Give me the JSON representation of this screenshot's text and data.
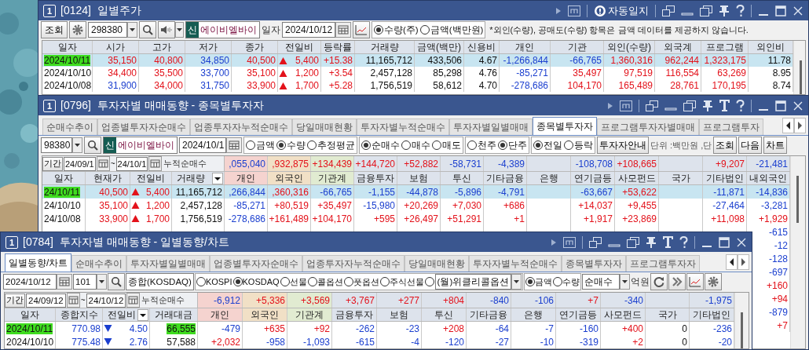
{
  "daily_price_window": {
    "screen_badge": "1",
    "title": "[0124]  일별주가",
    "auto_log_label": "자동일지",
    "toolbar": {
      "query_button": "조회",
      "code": "298380",
      "market_badge": "신",
      "stock_name": "에이비엘바이",
      "date_label": "일자",
      "date": "2024/10/12",
      "unit_options": [
        {
          "label": "수량(주)",
          "selected": true
        },
        {
          "label": "금액(백만원)",
          "selected": false
        }
      ],
      "notice": "*외인(수량), 공매도(수량) 항목은 금액 데이터를 제공하지 않습니다."
    },
    "table": {
      "columns": [
        {
          "label": "일자",
          "kind": "text"
        },
        {
          "label": "시가",
          "kind": "text"
        },
        {
          "label": "고가",
          "kind": "text"
        },
        {
          "label": "저가",
          "kind": "text"
        },
        {
          "label": "종가",
          "kind": "text"
        },
        {
          "label": "전일비",
          "kind": "change"
        },
        {
          "label": "등락률",
          "kind": "text"
        },
        {
          "label": "거래량",
          "kind": "text"
        },
        {
          "label": "금액(백만)",
          "kind": "text"
        },
        {
          "label": "신용비",
          "kind": "text"
        },
        {
          "label": "개인",
          "kind": "text"
        },
        {
          "label": "기관",
          "kind": "text"
        },
        {
          "label": "외인(수량)",
          "kind": "text"
        },
        {
          "label": "외국계",
          "kind": "text"
        },
        {
          "label": "프로그램",
          "kind": "text"
        },
        {
          "label": "외인비",
          "kind": "text"
        }
      ],
      "rows": [
        {
          "selected": true,
          "cells": [
            {
              "text": "2024/10/11",
              "highlighted": true
            },
            {
              "text": "35,150",
              "color": "#e3121b"
            },
            {
              "text": "40,800",
              "color": "#e3121b"
            },
            {
              "text": "34,850",
              "color": "#1b3fcf"
            },
            {
              "text": "40,500",
              "color": "#e3121b"
            },
            {
              "text": "5,400",
              "color": "#e3121b",
              "rising": true
            },
            {
              "text": "+15.38",
              "color": "#e3121b"
            },
            {
              "text": "11,165,712"
            },
            {
              "text": "433,506"
            },
            {
              "text": "4.67"
            },
            {
              "text": "-1,266,844",
              "color": "#1b3fcf"
            },
            {
              "text": "-66,765",
              "color": "#1b3fcf"
            },
            {
              "text": "1,360,316",
              "color": "#e3121b"
            },
            {
              "text": "962,244",
              "color": "#e3121b"
            },
            {
              "text": "1,323,175",
              "color": "#e3121b"
            },
            {
              "text": "11.78"
            }
          ]
        },
        {
          "selected": false,
          "cells": [
            {
              "text": "2024/10/10",
              "highlighted": false
            },
            {
              "text": "34,400",
              "color": "#e3121b"
            },
            {
              "text": "35,500",
              "color": "#e3121b"
            },
            {
              "text": "33,700",
              "color": "#1b3fcf"
            },
            {
              "text": "35,100",
              "color": "#e3121b"
            },
            {
              "text": "1,200",
              "color": "#e3121b",
              "rising": true
            },
            {
              "text": "+3.54",
              "color": "#e3121b"
            },
            {
              "text": "2,457,128"
            },
            {
              "text": "85,298"
            },
            {
              "text": "4.76"
            },
            {
              "text": "-85,271",
              "color": "#1b3fcf"
            },
            {
              "text": "35,497",
              "color": "#e3121b"
            },
            {
              "text": "97,519",
              "color": "#e3121b"
            },
            {
              "text": "116,554",
              "color": "#e3121b"
            },
            {
              "text": "63,269",
              "color": "#e3121b"
            },
            {
              "text": "8.95"
            }
          ]
        },
        {
          "selected": false,
          "cells": [
            {
              "text": "2024/10/08",
              "highlighted": false
            },
            {
              "text": "31,900",
              "color": "#1b3fcf"
            },
            {
              "text": "34,000",
              "color": "#e3121b"
            },
            {
              "text": "31,750",
              "color": "#1b3fcf"
            },
            {
              "text": "33,900",
              "color": "#e3121b"
            },
            {
              "text": "1,700",
              "color": "#e3121b",
              "rising": true
            },
            {
              "text": "+5.28",
              "color": "#e3121b"
            },
            {
              "text": "1,756,519"
            },
            {
              "text": "58,612"
            },
            {
              "text": "4.70"
            },
            {
              "text": "-278,686",
              "color": "#1b3fcf"
            },
            {
              "text": "104,170",
              "color": "#e3121b"
            },
            {
              "text": "165,489",
              "color": "#e3121b"
            },
            {
              "text": "28,761",
              "color": "#e3121b"
            },
            {
              "text": "170,195",
              "color": "#e3121b"
            },
            {
              "text": "8.74"
            }
          ]
        }
      ]
    }
  },
  "investor_by_stock_window": {
    "screen_badge": "1",
    "title": "[0796]  투자자별 매매동향 - 종목별투자자",
    "tabs": [
      {
        "label": "순매수추이",
        "selected": false
      },
      {
        "label": "업종별투자자순매수",
        "selected": false
      },
      {
        "label": "업종투자자누적순매수",
        "selected": false
      },
      {
        "label": "당일매매현황",
        "selected": false
      },
      {
        "label": "투자자별누적순매수",
        "selected": false
      },
      {
        "label": "투자자별일별매매",
        "selected": false
      },
      {
        "label": "종목별투자자",
        "selected": true
      },
      {
        "label": "프로그램투자자별매매",
        "selected": false
      },
      {
        "label": "프로그램투자",
        "selected": false
      }
    ],
    "toolbar": {
      "code": "98380",
      "market_badge": "신",
      "stock_name": "에이비엘바이",
      "date": "2024/10/1",
      "radio_groups": [
        [
          {
            "label": "금액",
            "selected": false
          },
          {
            "label": "수량",
            "selected": true
          },
          {
            "label": "추정평균",
            "selected": false
          }
        ],
        [
          {
            "label": "순매수",
            "selected": true
          },
          {
            "label": "매수",
            "selected": false
          },
          {
            "label": "매도",
            "selected": false
          }
        ],
        [
          {
            "label": "천주",
            "selected": false
          },
          {
            "label": "단주",
            "selected": true
          }
        ],
        [
          {
            "label": "전일",
            "selected": true
          },
          {
            "label": "등락",
            "selected": false
          }
        ]
      ],
      "guide_button": "투자자안내",
      "unit_note": "단위 :백만원 ,단",
      "buttons": [
        "조회",
        "다음",
        "차트"
      ]
    },
    "summary": {
      "period_button": "기간",
      "from": "24/09/1",
      "tilde": "~",
      "to": "24/10/1",
      "label": "누적순매수"
    },
    "table": {
      "columns": [
        {
          "label": "일자",
          "kind": "text"
        },
        {
          "label": "현재가",
          "kind": "text"
        },
        {
          "label": "전일비",
          "kind": "change"
        },
        {
          "label": "거래량",
          "kind": "text",
          "has_menu": true
        },
        {
          "label": "개인",
          "kind": "text",
          "color": "#f5d3cf",
          "total": {
            "text": ",055,040",
            "color": "#1b3fcf"
          }
        },
        {
          "label": "외국인",
          "kind": "text",
          "color": "#f1e0c6",
          "total": {
            "text": ",932,875",
            "color": "#e3121b"
          }
        },
        {
          "label": "기관계",
          "kind": "text",
          "color": "#e1ebd1",
          "total": {
            "text": "+134,439",
            "color": "#e3121b"
          }
        },
        {
          "label": "금융투자",
          "kind": "text",
          "total": {
            "text": "+144,720",
            "color": "#e3121b"
          }
        },
        {
          "label": "보험",
          "kind": "text",
          "total": {
            "text": "+52,882",
            "color": "#e3121b"
          }
        },
        {
          "label": "투신",
          "kind": "text",
          "total": {
            "text": "-58,731",
            "color": "#1b3fcf"
          }
        },
        {
          "label": "기타금융",
          "kind": "text",
          "total": {
            "text": "-4,389",
            "color": "#1b3fcf"
          }
        },
        {
          "label": "은행",
          "kind": "text"
        },
        {
          "label": "연기금등",
          "kind": "text",
          "total": {
            "text": "-108,708",
            "color": "#1b3fcf"
          }
        },
        {
          "label": "사모펀드",
          "kind": "text",
          "total": {
            "text": "+108,665",
            "color": "#e3121b"
          }
        },
        {
          "label": "국가",
          "kind": "text"
        },
        {
          "label": "기타법인",
          "kind": "text",
          "total": {
            "text": "+9,207",
            "color": "#e3121b"
          }
        },
        {
          "label": "내외국인",
          "kind": "text",
          "total": {
            "text": "-21,481",
            "color": "#1b3fcf"
          }
        }
      ],
      "rows": [
        {
          "selected": true,
          "cells": [
            {
              "text": "24/10/11",
              "highlighted": true
            },
            {
              "text": "40,500",
              "color": "#e3121b"
            },
            {
              "text": "5,400",
              "color": "#e3121b",
              "rising": true
            },
            {
              "text": "11,165,712"
            },
            {
              "text": ",266,844",
              "color": "#1b3fcf"
            },
            {
              "text": ",360,316",
              "color": "#e3121b"
            },
            {
              "text": "-66,765",
              "color": "#1b3fcf"
            },
            {
              "text": "-1,155",
              "color": "#1b3fcf"
            },
            {
              "text": "-44,878",
              "color": "#1b3fcf"
            },
            {
              "text": "-5,896",
              "color": "#1b3fcf"
            },
            {
              "text": "-4,791",
              "color": "#1b3fcf"
            },
            {},
            {
              "text": "-63,667",
              "color": "#1b3fcf"
            },
            {
              "text": "+53,622",
              "color": "#e3121b"
            },
            {},
            {
              "text": "-11,871",
              "color": "#1b3fcf"
            },
            {
              "text": "-14,836",
              "color": "#1b3fcf"
            }
          ]
        },
        {
          "selected": false,
          "cells": [
            {
              "text": "24/10/10",
              "highlighted": false
            },
            {
              "text": "35,100",
              "color": "#e3121b"
            },
            {
              "text": "1,200",
              "color": "#e3121b",
              "rising": true
            },
            {
              "text": "2,457,128"
            },
            {
              "text": "-85,271",
              "color": "#1b3fcf"
            },
            {
              "text": "+80,519",
              "color": "#e3121b"
            },
            {
              "text": "+35,497",
              "color": "#e3121b"
            },
            {
              "text": "-15,980",
              "color": "#1b3fcf"
            },
            {
              "text": "+20,269",
              "color": "#e3121b"
            },
            {
              "text": "+7,030",
              "color": "#e3121b"
            },
            {
              "text": "+686",
              "color": "#e3121b"
            },
            {},
            {
              "text": "+14,037",
              "color": "#e3121b"
            },
            {
              "text": "+9,455",
              "color": "#e3121b"
            },
            {},
            {
              "text": "-27,464",
              "color": "#1b3fcf"
            },
            {
              "text": "-3,281",
              "color": "#1b3fcf"
            }
          ]
        },
        {
          "selected": false,
          "cells": [
            {
              "text": "24/10/08",
              "highlighted": false
            },
            {
              "text": "33,900",
              "color": "#e3121b"
            },
            {
              "text": "1,700",
              "color": "#e3121b",
              "rising": true
            },
            {
              "text": "1,756,519"
            },
            {
              "text": "-278,686",
              "color": "#1b3fcf"
            },
            {
              "text": "+161,489",
              "color": "#e3121b"
            },
            {
              "text": "+104,170",
              "color": "#e3121b"
            },
            {
              "text": "+595",
              "color": "#e3121b"
            },
            {
              "text": "+26,497",
              "color": "#e3121b"
            },
            {
              "text": "+51,291",
              "color": "#e3121b"
            },
            {
              "text": "+1",
              "color": "#e3121b"
            },
            {},
            {
              "text": "+1,917",
              "color": "#e3121b"
            },
            {
              "text": "+23,869",
              "color": "#e3121b"
            },
            {},
            {
              "text": "+11,098",
              "color": "#e3121b"
            },
            {
              "text": "+1,929",
              "color": "#e3121b"
            }
          ]
        }
      ],
      "lower_last_column": [
        {
          "text": "-615",
          "color": "#1b3fcf"
        },
        {
          "text": "-12",
          "color": "#1b3fcf"
        },
        {
          "text": "-128",
          "color": "#1b3fcf"
        },
        {
          "text": "-697",
          "color": "#1b3fcf"
        },
        {
          "text": "+160",
          "color": "#e3121b"
        },
        {
          "text": "+94",
          "color": "#e3121b"
        },
        {
          "text": "-879",
          "color": "#1b3fcf"
        },
        {
          "text": "+7",
          "color": "#e3121b"
        }
      ]
    }
  },
  "daily_trend_window": {
    "screen_badge": "1",
    "title": "[0784]  투자자별 매매동향 - 일별동향/차트",
    "tabs": [
      {
        "label": "일별동향/차트",
        "selected": true
      },
      {
        "label": "순매수추이",
        "selected": false
      },
      {
        "label": "투자자별일별매매",
        "selected": false
      },
      {
        "label": "업종별투자자순매수",
        "selected": false
      },
      {
        "label": "업종투자자누적순매수",
        "selected": false
      },
      {
        "label": "당일매매현황",
        "selected": false
      },
      {
        "label": "투자자별누적순매수",
        "selected": false
      },
      {
        "label": "종목별투자자",
        "selected": false
      },
      {
        "label": "프로그램투자자",
        "selected": false
      }
    ],
    "toolbar": {
      "date": "2024/10/12",
      "code": "101",
      "index_name": "종합(KOSDAQ)",
      "market_options": [
        {
          "label": "KOSPI",
          "selected": false
        },
        {
          "label": "KOSDAQ",
          "selected": true
        },
        {
          "label": "선물",
          "selected": false
        },
        {
          "label": "콜옵션",
          "selected": false
        },
        {
          "label": "풋옵션",
          "selected": false
        },
        {
          "label": "주식선물",
          "selected": false
        }
      ],
      "weekly_option": {
        "selected": false,
        "value": "(월)위클리콜옵션"
      },
      "value_options": [
        {
          "label": "금액",
          "selected": true
        },
        {
          "label": "수량",
          "selected": false
        }
      ],
      "mode": "순매수",
      "unit": "억원"
    },
    "summary": {
      "period_button": "기간",
      "from": "24/09/12",
      "tilde": "~",
      "to": "24/10/12",
      "label": "누적순매수"
    },
    "table": {
      "columns": [
        {
          "label": "일자",
          "kind": "text"
        },
        {
          "label": "종합지수",
          "kind": "text"
        },
        {
          "label": "전일비",
          "kind": "change",
          "has_menu": true
        },
        {
          "label": "거래대금",
          "kind": "text"
        },
        {
          "label": "개인",
          "kind": "text",
          "color": "#f5d3cf",
          "total": {
            "text": "-6,912",
            "color": "#1b3fcf"
          }
        },
        {
          "label": "외국인",
          "kind": "text",
          "color": "#f1e0c6",
          "total": {
            "text": "+5,336",
            "color": "#e3121b"
          }
        },
        {
          "label": "기관계",
          "kind": "text",
          "color": "#e1ebd1",
          "total": {
            "text": "+3,569",
            "color": "#e3121b"
          }
        },
        {
          "label": "금융투자",
          "kind": "text",
          "total": {
            "text": "+3,767",
            "color": "#e3121b"
          }
        },
        {
          "label": "보험",
          "kind": "text",
          "total": {
            "text": "+277",
            "color": "#e3121b"
          }
        },
        {
          "label": "투신",
          "kind": "text",
          "total": {
            "text": "+804",
            "color": "#e3121b"
          }
        },
        {
          "label": "기타금융",
          "kind": "text",
          "total": {
            "text": "-840",
            "color": "#1b3fcf"
          }
        },
        {
          "label": "은행",
          "kind": "text",
          "total": {
            "text": "-106",
            "color": "#1b3fcf"
          }
        },
        {
          "label": "연기금등",
          "kind": "text",
          "total": {
            "text": "+7",
            "color": "#e3121b"
          }
        },
        {
          "label": "사모펀드",
          "kind": "text",
          "total": {
            "text": "-340",
            "color": "#1b3fcf"
          }
        },
        {
          "label": "국가",
          "kind": "text"
        },
        {
          "label": "기타법인",
          "kind": "text",
          "total": {
            "text": "-1,975",
            "color": "#1b3fcf"
          }
        }
      ],
      "rows": [
        {
          "selected": false,
          "cells": [
            {
              "text": "2024/10/11",
              "highlighted": true
            },
            {
              "text": "770.98",
              "color": "#1b3fcf"
            },
            {
              "text": "4.50",
              "color": "#1b3fcf",
              "rising": false
            },
            {
              "text": "66,555",
              "highlighted": true
            },
            {
              "text": "-479",
              "color": "#1b3fcf"
            },
            {
              "text": "+635",
              "color": "#e3121b"
            },
            {
              "text": "+92",
              "color": "#e3121b"
            },
            {
              "text": "-262",
              "color": "#1b3fcf"
            },
            {
              "text": "-23",
              "color": "#1b3fcf"
            },
            {
              "text": "+208",
              "color": "#e3121b"
            },
            {
              "text": "-64",
              "color": "#1b3fcf"
            },
            {
              "text": "-7",
              "color": "#1b3fcf"
            },
            {
              "text": "-160",
              "color": "#1b3fcf"
            },
            {
              "text": "+400",
              "color": "#e3121b"
            },
            {
              "text": "0"
            },
            {
              "text": "-236",
              "color": "#1b3fcf"
            }
          ]
        },
        {
          "selected": false,
          "cells": [
            {
              "text": "2024/10/10",
              "highlighted": false
            },
            {
              "text": "775.48",
              "color": "#1b3fcf"
            },
            {
              "text": "2.76",
              "color": "#1b3fcf",
              "rising": false
            },
            {
              "text": "57,588",
              "highlighted": false
            },
            {
              "text": "+2,032",
              "color": "#e3121b"
            },
            {
              "text": "-958",
              "color": "#1b3fcf"
            },
            {
              "text": "-1,093",
              "color": "#1b3fcf"
            },
            {
              "text": "-615",
              "color": "#1b3fcf"
            },
            {
              "text": "-4",
              "color": "#1b3fcf"
            },
            {
              "text": "-120",
              "color": "#1b3fcf"
            },
            {
              "text": "-27",
              "color": "#1b3fcf"
            },
            {
              "text": "-10",
              "color": "#1b3fcf"
            },
            {
              "text": "-319",
              "color": "#1b3fcf"
            },
            {
              "text": "+2",
              "color": "#e3121b"
            },
            {
              "text": "0"
            },
            {
              "text": "-20",
              "color": "#1b3fcf"
            }
          ]
        }
      ]
    }
  }
}
